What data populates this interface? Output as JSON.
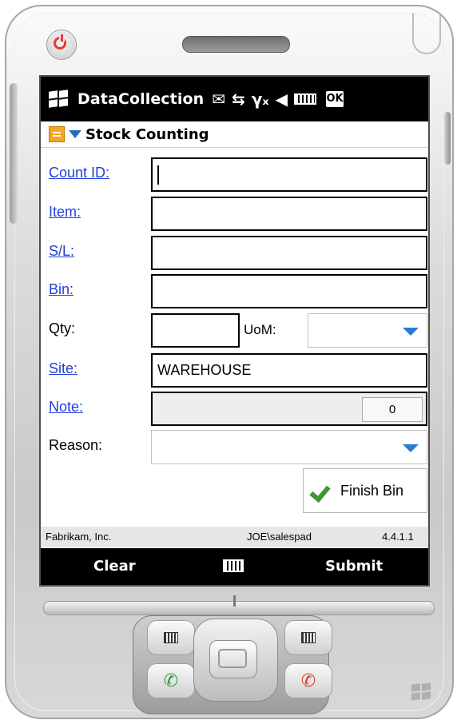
{
  "status_bar": {
    "app_title": "DataCollection",
    "icons": [
      "windows-flag-icon",
      "messaging-icon",
      "sync-icon",
      "signal-off-icon",
      "volume-icon",
      "battery-icon"
    ],
    "ok_label": "OK"
  },
  "title_bar": {
    "title": "Stock Counting"
  },
  "form": {
    "count_id": {
      "label": "Count ID:",
      "value": ""
    },
    "item": {
      "label": "Item:",
      "value": ""
    },
    "sl": {
      "label": "S/L:",
      "value": ""
    },
    "bin": {
      "label": "Bin:",
      "value": ""
    },
    "qty": {
      "label": "Qty:",
      "value": ""
    },
    "uom": {
      "label": "UoM:",
      "value": ""
    },
    "site": {
      "label": "Site:",
      "value": "WAREHOUSE"
    },
    "note": {
      "label": "Note:",
      "count": "0"
    },
    "reason": {
      "label": "Reason:",
      "value": ""
    },
    "finish_bin_label": "Finish Bin"
  },
  "info_bar": {
    "company": "Fabrikam, Inc.",
    "user": "JOE\\salespad",
    "version": "4.4.1.1"
  },
  "softkeys": {
    "left": "Clear",
    "right": "Submit"
  },
  "colors": {
    "link": "#1f3fd6",
    "accent_arrow": "#2b7ad3",
    "menu_icon": "#f5a623",
    "check": "#3c9a2f"
  }
}
